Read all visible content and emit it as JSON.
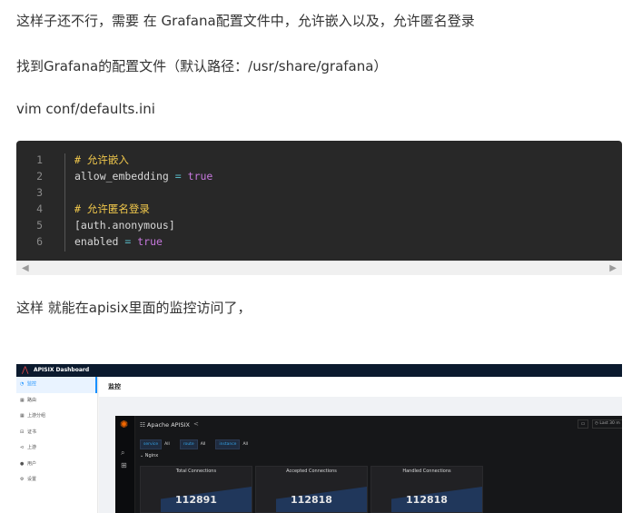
{
  "paragraphs": {
    "p1": "这样子还不行，需要 在 Grafana配置文件中，允许嵌入以及，允许匿名登录",
    "p2": "找到Grafana的配置文件（默认路径：/usr/share/grafana）",
    "p3": "vim conf/defaults.ini",
    "p4": "这样 就能在apisix里面的监控访问了，"
  },
  "code": {
    "line_numbers": [
      "1",
      "2",
      "3",
      "4",
      "5",
      "6"
    ],
    "lines": [
      {
        "comment": "# 允许嵌入"
      },
      {
        "key": "allow_embedding",
        "op": " = ",
        "value": "true"
      },
      {},
      {
        "comment": "# 允许匿名登录"
      },
      {
        "text": "[auth.anonymous]"
      },
      {
        "key": "enabled",
        "op": " = ",
        "value": "true"
      }
    ]
  },
  "scroll": {
    "left_icon": "triangle-left",
    "right_icon": "triangle-right"
  },
  "screenshot": {
    "app_title": "APISIX Dashboard",
    "sidebar": [
      {
        "icon": "monitor",
        "label": "监控",
        "active": true
      },
      {
        "icon": "route",
        "label": "路由",
        "active": false
      },
      {
        "icon": "upstream",
        "label": "上游分组",
        "active": false
      },
      {
        "icon": "ssl",
        "label": "证书",
        "active": false
      },
      {
        "icon": "service",
        "label": "上游",
        "active": false
      },
      {
        "icon": "consumer",
        "label": "用户",
        "active": false
      },
      {
        "icon": "settings",
        "label": "设置",
        "active": false
      }
    ],
    "page_title": "监控",
    "grafana": {
      "dashboard_title": "Apache APISIX",
      "time_range": "Last 30 m",
      "variables": [
        {
          "name": "service",
          "value": "All"
        },
        {
          "name": "route",
          "value": "All"
        },
        {
          "name": "instance",
          "value": "All"
        }
      ],
      "row_title": "Nginx",
      "panels": [
        {
          "title": "Total Connections",
          "value": "112891"
        },
        {
          "title": "Accepted Connections",
          "value": "112818"
        },
        {
          "title": "Handled Connections",
          "value": "112818"
        }
      ]
    }
  }
}
